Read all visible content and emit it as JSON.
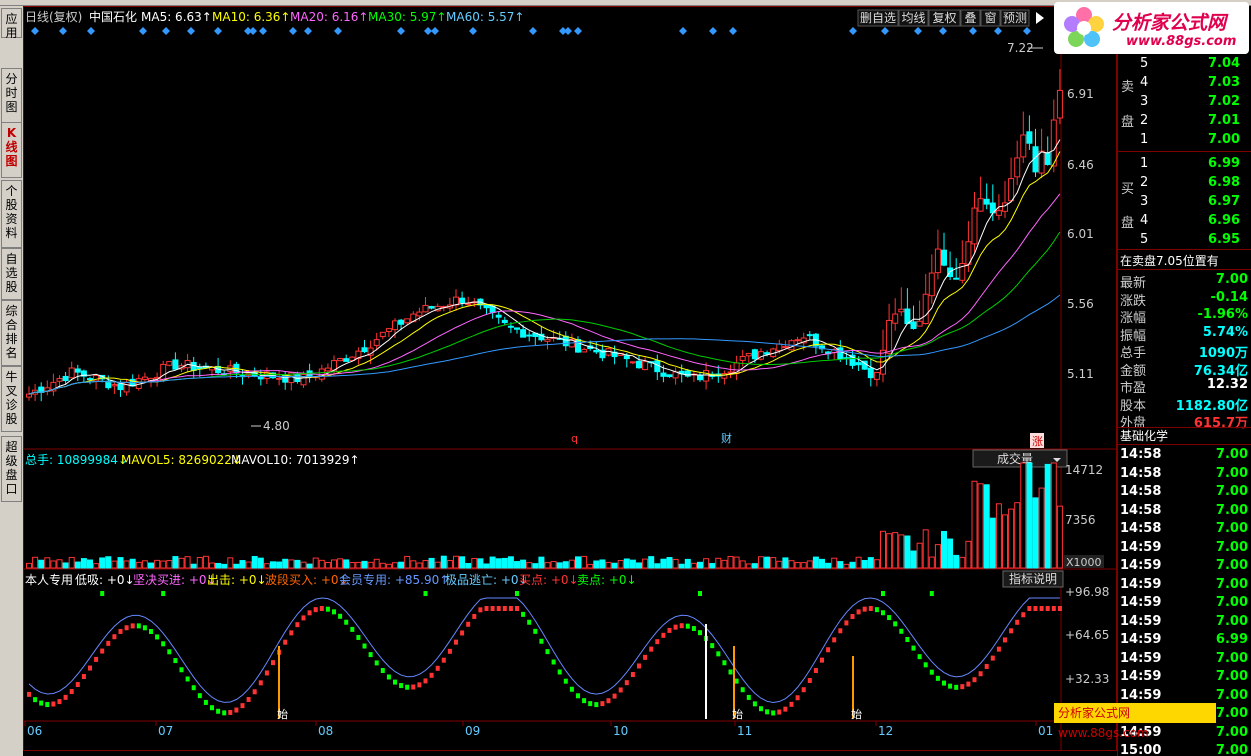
{
  "header": {
    "period": "日线(复权)",
    "stock": "中国石化",
    "ma": [
      {
        "label": "MA5: 6.63",
        "color": "#ffffff"
      },
      {
        "label": "MA10: 6.36",
        "color": "#ffff00"
      },
      {
        "label": "MA20: 6.16",
        "color": "#ff66ff"
      },
      {
        "label": "MA30: 5.97",
        "color": "#00ff00"
      },
      {
        "label": "MA60: 5.57",
        "color": "#66ccff"
      }
    ],
    "buttons": [
      "删自选",
      "均线",
      "复权",
      "叠",
      "窗",
      "预测"
    ]
  },
  "left_tabs": [
    {
      "label": "应用",
      "active": false
    },
    {
      "label": "分时图",
      "active": false
    },
    {
      "label": "K线图",
      "active": true
    },
    {
      "label": "个股资料",
      "active": false
    },
    {
      "label": "自选股",
      "active": false
    },
    {
      "label": "综合排名",
      "active": false
    },
    {
      "label": "牛叉诊股",
      "active": false
    },
    {
      "label": "超级盘口",
      "active": false
    }
  ],
  "price_axis": [
    "6.91",
    "6.46",
    "6.01",
    "5.56",
    "5.11"
  ],
  "labels": {
    "high": "7.22",
    "low": "4.80",
    "q": "q",
    "cai": "财",
    "zhang": "涨"
  },
  "volume": {
    "total": "总手: 10899984",
    "mavol5": "MAVOL5: 8269022",
    "mavol10": "MAVOL10: 7013929",
    "dropdown": "成交量",
    "axis": [
      "14712",
      "7356",
      "X1000"
    ]
  },
  "indicator": {
    "title": "本人专用",
    "items": [
      {
        "t": "低吸: +0",
        "c": "#ffffff"
      },
      {
        "t": "坚决买进: +0",
        "c": "#ff66ff"
      },
      {
        "t": "出击: +0",
        "c": "#ffff00"
      },
      {
        "t": "波段买入: +0",
        "c": "#ff6600"
      },
      {
        "t": "会员专用: +85.90",
        "c": "#6699ff"
      },
      {
        "t": "极品逃亡: +0",
        "c": "#66ccff"
      },
      {
        "t": "买点: +0",
        "c": "#ff3333"
      },
      {
        "t": "卖点: +0",
        "c": "#00ff00"
      }
    ],
    "button": "指标说明",
    "axis": [
      "+96.98",
      "+64.65",
      "+32.33"
    ],
    "shi": "始"
  },
  "dates": [
    "06",
    "07",
    "08",
    "09",
    "10",
    "11",
    "12",
    "01"
  ],
  "watermark": "分析家公式网 www.88gs.com",
  "logo": {
    "name": "分析家公式网",
    "url": "www.88gs.com"
  },
  "chart_data": {
    "type": "candlestick",
    "high": 7.22,
    "low": 4.8,
    "ylim": [
      4.8,
      7.3
    ]
  },
  "orderbook": {
    "sell_label": "卖盘",
    "buy_label": "买盘",
    "sell": [
      {
        "n": "5",
        "p": "7.04"
      },
      {
        "n": "4",
        "p": "7.03"
      },
      {
        "n": "3",
        "p": "7.02"
      },
      {
        "n": "2",
        "p": "7.01"
      },
      {
        "n": "1",
        "p": "7.00"
      }
    ],
    "buy": [
      {
        "n": "1",
        "p": "6.99"
      },
      {
        "n": "2",
        "p": "6.98"
      },
      {
        "n": "3",
        "p": "6.97"
      },
      {
        "n": "4",
        "p": "6.96"
      },
      {
        "n": "5",
        "p": "6.95"
      }
    ],
    "status": "在卖盘7.05位置有"
  },
  "stats": [
    {
      "k": "最新",
      "v": "7.00",
      "c": "#00ff00"
    },
    {
      "k": "涨跌",
      "v": "-0.14",
      "c": "#00ff00"
    },
    {
      "k": "涨幅",
      "v": "-1.96%",
      "c": "#00ff00"
    },
    {
      "k": "振幅",
      "v": "5.74%",
      "c": "#00ffff"
    },
    {
      "k": "总手",
      "v": "1090万",
      "c": "#00ffff"
    },
    {
      "k": "金额",
      "v": "76.34亿",
      "c": "#00ffff"
    },
    {
      "k": "市盈",
      "v": "12.32",
      "c": "#ffffff"
    },
    {
      "k": "股本",
      "v": "1182.80亿",
      "c": "#00ffff"
    },
    {
      "k": "外盘",
      "v": "615.7万",
      "c": "#ff3333"
    }
  ],
  "industry": "基础化学",
  "ticks": [
    {
      "t": "14:58",
      "p": "7.00"
    },
    {
      "t": "14:58",
      "p": "7.00"
    },
    {
      "t": "14:58",
      "p": "7.00"
    },
    {
      "t": "14:58",
      "p": "7.00"
    },
    {
      "t": "14:58",
      "p": "7.00"
    },
    {
      "t": "14:59",
      "p": "7.00"
    },
    {
      "t": "14:59",
      "p": "7.00"
    },
    {
      "t": "14:59",
      "p": "7.00"
    },
    {
      "t": "14:59",
      "p": "7.00"
    },
    {
      "t": "14:59",
      "p": "7.00"
    },
    {
      "t": "14:59",
      "p": "6.99"
    },
    {
      "t": "14:59",
      "p": "7.00"
    },
    {
      "t": "14:59",
      "p": "7.00"
    },
    {
      "t": "14:59",
      "p": "7.00"
    },
    {
      "t": "14:59",
      "p": "7.00"
    },
    {
      "t": "14:59",
      "p": "7.00"
    },
    {
      "t": "15:00",
      "p": "7.00"
    }
  ]
}
